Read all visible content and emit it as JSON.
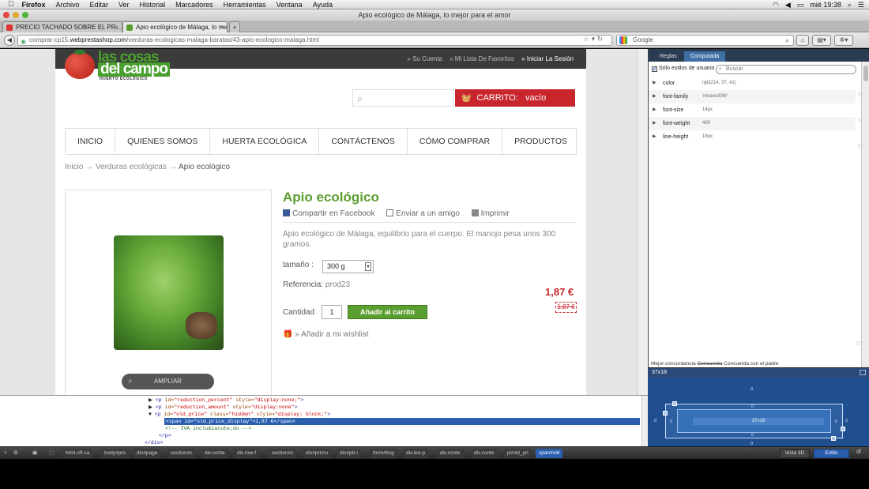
{
  "menubar": {
    "app": "Firefox",
    "items": [
      "Archivo",
      "Editar",
      "Ver",
      "Historial",
      "Marcadores",
      "Herramientas",
      "Ventana",
      "Ayuda"
    ],
    "clock": "mié 19:38"
  },
  "window": {
    "title": "Apio ecológico de Málaga, lo mejor para el amor"
  },
  "tabs": [
    {
      "label": "PRECIO TACHADO SOBRE EL PR...",
      "active": false
    },
    {
      "label": "Apio ecológico de Málaga, lo me...",
      "active": true
    }
  ],
  "nav": {
    "url_prefix": "comprar-cp15.",
    "url_host": "webprestashop.com",
    "url_path": "/verduras-ecologicas-malaga-baratas/43-apio-ecologico-malaga.html",
    "search_placeholder": "Google"
  },
  "site": {
    "logo_line1": "las cosas",
    "logo_line2": "del campo",
    "logo_line3": "HUERTO ECOLÓGICO",
    "toplinks": [
      "» Su Cuenta",
      "» Mi Lista De Favoritos",
      "» Iniciar La Sesión"
    ],
    "cart_label": "CARRITO:",
    "cart_status": "vacío",
    "menu": [
      "INICIO",
      "QUIENES SOMOS",
      "HUERTA ECOLÓGICA",
      "CONTÁCTENOS",
      "CÓMO COMPRAR",
      "PRODUCTOS"
    ],
    "breadcrumb": [
      "Inicio",
      "Verduras ecológicas",
      "Apio ecológico"
    ],
    "breadcrumb_sep": "→",
    "ampliar": "AMPLIAR"
  },
  "product": {
    "title": "Apio ecológico",
    "share_facebook": "Compartir en Facebook",
    "send_friend": "Enviar a un amigo",
    "print": "Imprimir",
    "description": "Apio ecológico de Málaga, equilibrio para el cuerpo. El manojo pesa unos 300 gramos.",
    "size_label": "tamaño :",
    "size_value": "300 g",
    "reference_label": "Referencia:",
    "reference_value": "prod23",
    "price": "1,87 €",
    "old_price": "1,87 €",
    "quantity_label": "Cantidad",
    "quantity_value": "1",
    "add_to_cart": "Añadir al carrito",
    "wishlist": "» Añadir a mi wishlist"
  },
  "styles_panel": {
    "tabs": [
      "Reglas",
      "Computada"
    ],
    "user_styles_label": "Sólo estilos de usuario",
    "filter_placeholder": "Buscar",
    "properties": [
      {
        "name": "color",
        "value": "rgb(214, 37, 41)"
      },
      {
        "name": "font-family",
        "value": "'museo300r'"
      },
      {
        "name": "font-size",
        "value": "14px"
      },
      {
        "name": "font-weight",
        "value": "400"
      },
      {
        "name": "line-height",
        "value": "18px"
      }
    ],
    "match_best": "Mejor concordancia",
    "match_struck": "Concuerda",
    "match_parent": "Concuerda con el padre"
  },
  "box_model": {
    "header": "37x18",
    "content": "37x18",
    "zero": "0"
  },
  "html_panel": {
    "lines": [
      {
        "tag_open": "<p",
        "attr1": "id=",
        "val1": "\"reduction_percent\"",
        "attr2": "style=",
        "val2": "\"display:none;\"",
        "close": ">"
      },
      {
        "tag_open": "<p",
        "attr1": "id=",
        "val1": "\"reduction_amount\"",
        "attr2": "style=",
        "val2": "\"display:none\"",
        "close": ">"
      },
      {
        "tag_open": "<p",
        "attr1": "id=",
        "val1": "\"old_price\"",
        "attr2": "class=",
        "val2": "\"hidden\"",
        "attr3": "style=",
        "val3": "\"display: block;\"",
        "close": ">"
      },
      {
        "text": "<span id=\"old_price_display\">1,87 €</span>"
      },
      {
        "comment": "<!-- IVA inclu&iacute;do -->"
      },
      {
        "text": "</p>"
      },
      {
        "text": "</div>"
      }
    ]
  },
  "bottom_bar": {
    "crumbs": [
      "html.off-ca",
      "body#pro",
      "div#page",
      "section#c",
      "div.conta",
      "div.row-f",
      "section#c",
      "div#primu",
      "div#pb-l",
      "form#buy",
      "div.leo-p",
      "div.conte",
      "div.conte",
      "p#old_pri"
    ],
    "selected": "span#old",
    "view3d": "Vista 3D",
    "style_btn": "Estilo"
  },
  "edge_text": [
    "5",
    "5",
    "0",
    "57",
    "df"
  ]
}
